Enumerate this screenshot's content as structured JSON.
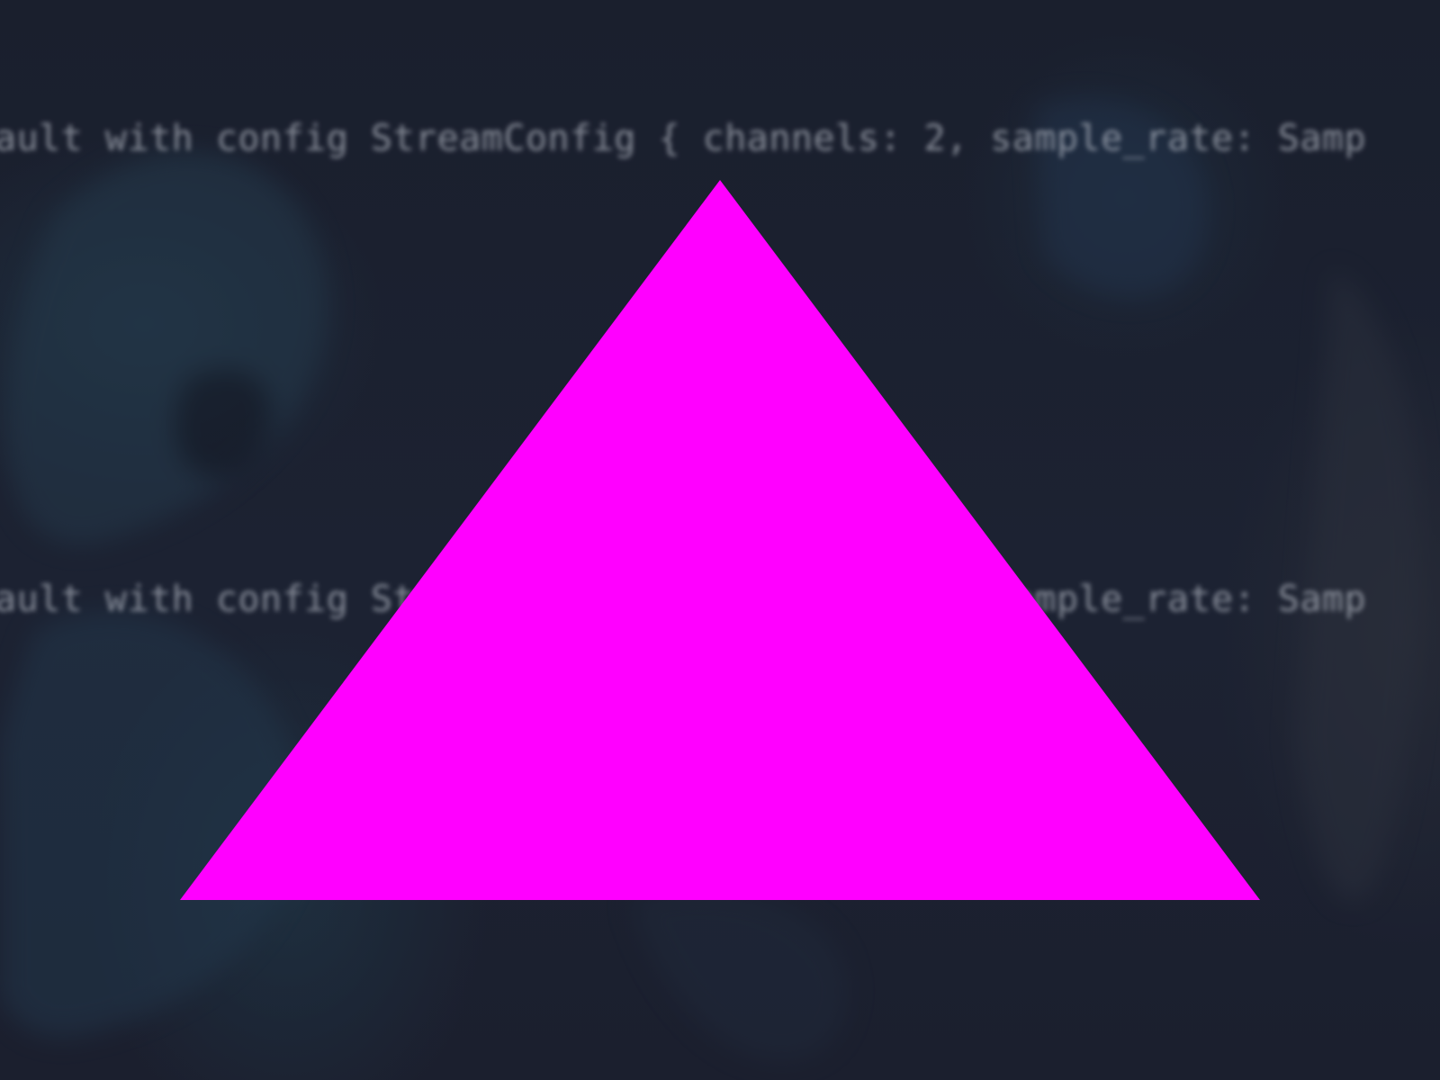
{
  "terminal": {
    "lines": [
      "ault with config StreamConfig { channels: 2, sample_rate: Samp",
      "ault with config StreamConfig { channels: 2, sample_rate: Samp"
    ]
  },
  "render": {
    "shape": "triangle",
    "fill_color": "#ff00ff",
    "background_color": "#1b1f2e"
  }
}
